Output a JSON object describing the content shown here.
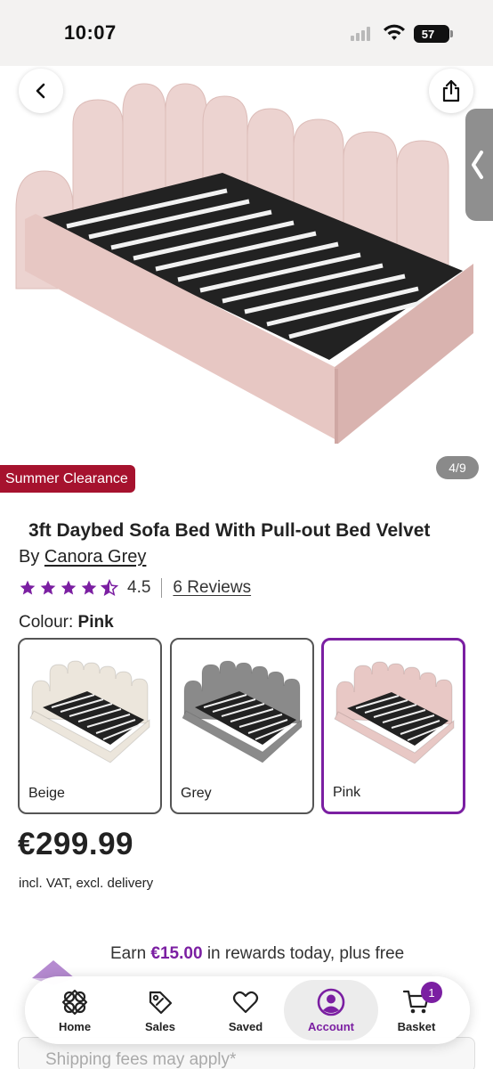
{
  "status_bar": {
    "time": "10:07",
    "battery": "57"
  },
  "gallery": {
    "counter": "4/9",
    "promo_badge": "Summer Clearance"
  },
  "product": {
    "title": "3ft Daybed Sofa Bed With Pull-out Bed Velvet",
    "by_label": "By",
    "brand": "Canora Grey",
    "rating": 4.5,
    "rating_text": "4.5",
    "reviews": "6 Reviews",
    "colour_label": "Colour:",
    "colour_selected": "Pink",
    "swatches": [
      {
        "label": "Beige",
        "color": "#ece6dc"
      },
      {
        "label": "Grey",
        "color": "#8a8a8a"
      },
      {
        "label": "Pink",
        "color": "#e8c8c5"
      }
    ],
    "price": "€299.99",
    "vat_note": "incl. VAT, excl. delivery"
  },
  "rewards": {
    "text_pre": "Earn",
    "amount": "€15.00",
    "text_post": "in rewards today, plus free"
  },
  "shipping": {
    "text": "Shipping fees may apply*"
  },
  "nav": {
    "items": [
      {
        "label": "Home",
        "icon": "home-icon"
      },
      {
        "label": "Sales",
        "icon": "tag-icon"
      },
      {
        "label": "Saved",
        "icon": "heart-icon"
      },
      {
        "label": "Account",
        "icon": "account-icon"
      },
      {
        "label": "Basket",
        "icon": "cart-icon"
      }
    ],
    "basket_count": "1"
  },
  "colors": {
    "accent": "#7b1fa2",
    "promo": "#a6122e",
    "star": "#7b1fa2"
  }
}
